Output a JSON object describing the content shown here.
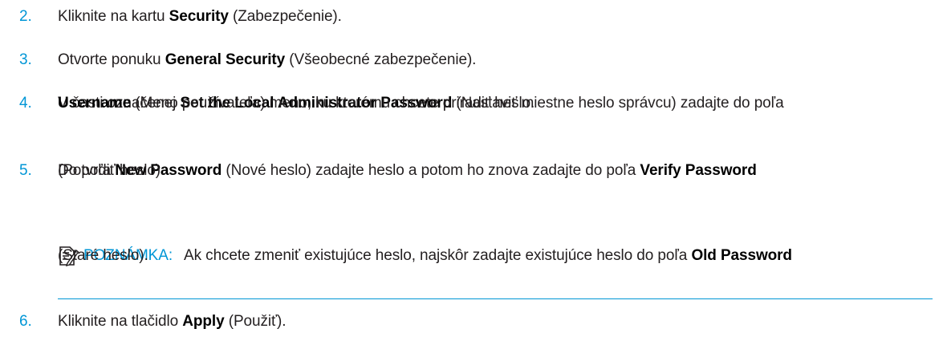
{
  "steps": [
    {
      "num": "2.",
      "pre": "Kliknite na kartu ",
      "b1": "Security",
      "post": " (Zabezpečenie)."
    },
    {
      "num": "3.",
      "pre": "Otvorte ponuku ",
      "b1": "General Security",
      "post": " (Všeobecné zabezpečenie)."
    },
    {
      "num": "4.",
      "pre": "V časti označenej ",
      "b1": "Set the Local Administrator Password",
      "mid": " (Nastaviť miestne heslo správcu) zadajte do poľa",
      "b2": "Username",
      "post": " (Meno používateľa) meno, ku ktorému chcete priradiť heslo."
    },
    {
      "num": "5.",
      "pre": "Do poľa ",
      "b1": "New Password",
      "mid": " (Nové heslo) zadajte heslo a potom ho znova zadajte do poľa ",
      "b2": "Verify Password",
      "post": "(Potvrdiť heslo)."
    },
    {
      "num": "6.",
      "pre": "Kliknite na tlačidlo ",
      "b1": "Apply",
      "post": " (Použiť)."
    }
  ],
  "note": {
    "icon": "note-icon",
    "label": "POZNÁMKA:",
    "pre": "Ak chcete zmeniť existujúce heslo, najskôr zadajte existujúce heslo do poľa ",
    "b1": "Old Password",
    "post": "(Staré heslo)."
  },
  "colors": {
    "accent": "#0096d6",
    "text": "#231f20"
  }
}
